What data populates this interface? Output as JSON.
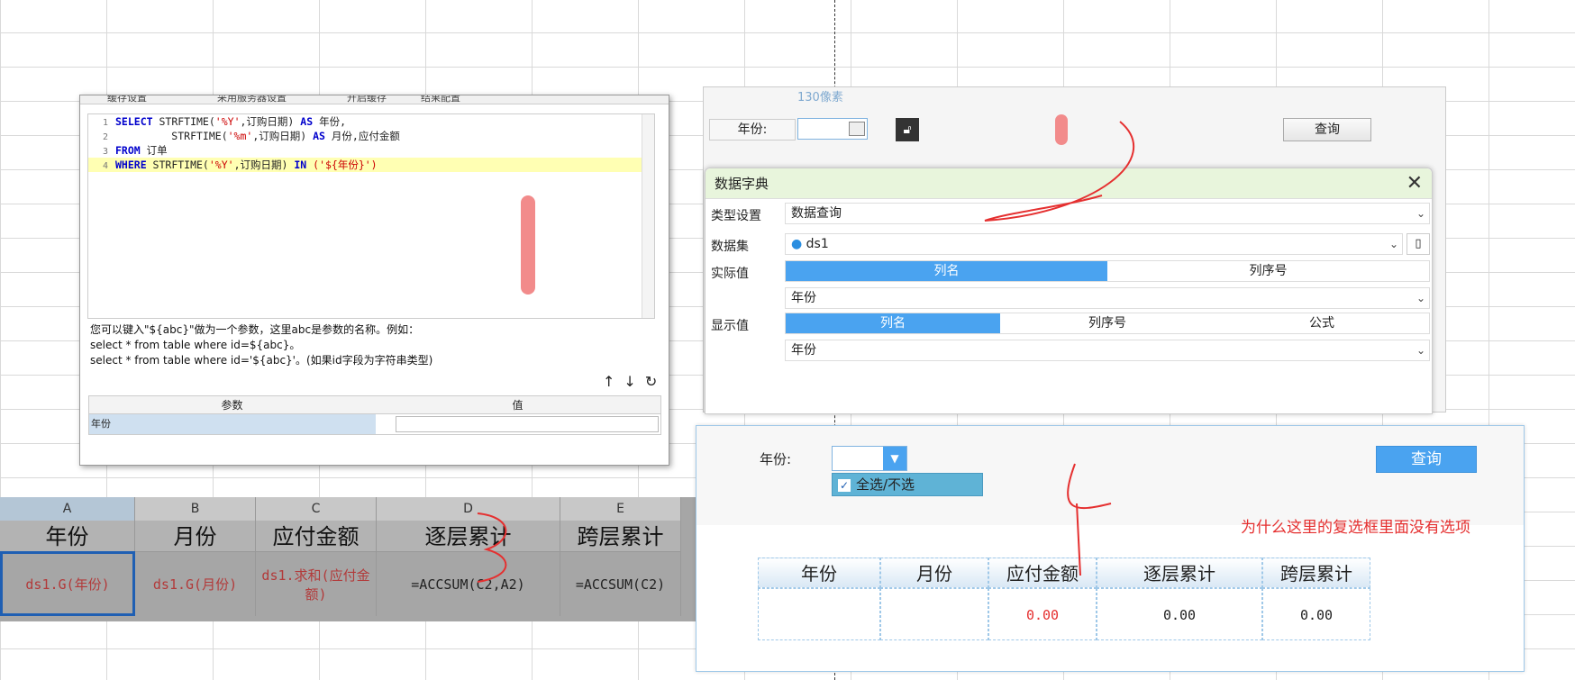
{
  "sql": {
    "toolbar_label": "缓存设置",
    "toolbar_select": "采用服务器设置",
    "toolbar_check": "开启缓存",
    "toolbar_button": "结果配置",
    "lines": [
      {
        "n": "1",
        "kw1": "SELECT",
        "t1": " STRFTIME(",
        "s1": "'%Y'",
        "t2": ",订购日期) ",
        "kw2": "AS",
        "t3": " 年份,"
      },
      {
        "n": "2",
        "kw1": "",
        "t1": "         STRFTIME(",
        "s1": "'%m'",
        "t2": ",订购日期) ",
        "kw2": "AS",
        "t3": " 月份,应付金额"
      },
      {
        "n": "3",
        "kw1": "FROM",
        "t1": " 订单",
        "s1": "",
        "t2": "",
        "kw2": "",
        "t3": ""
      },
      {
        "n": "4",
        "kw1": "WHERE",
        "t1": " STRFTIME(",
        "s1": "'%Y'",
        "t2": ",订购日期) ",
        "kw2": "IN",
        "t3": " ('${年份}')"
      }
    ],
    "hint1": "您可以键入\"${abc}\"做为一个参数，这里abc是参数的名称。例如：",
    "hint2": "select * from table where id=${abc}。",
    "hint3": "select * from table where id='${abc}'。(如果id字段为字符串类型)",
    "param_header": "参数",
    "value_header": "值",
    "param_name": "年份"
  },
  "sheet": {
    "cols": [
      "A",
      "B",
      "C",
      "D",
      "E"
    ],
    "headers": [
      "年份",
      "月份",
      "应付金额",
      "逐层累计",
      "跨层累计"
    ],
    "cells": [
      "ds1.G(年份)",
      "ds1.G(月份)",
      "ds1.求和(应付金额)",
      "=ACCSUM(C2,A2)",
      "=ACCSUM(C2)"
    ]
  },
  "preview_top": {
    "pixel_label": "130像素",
    "year_label": "年份:",
    "query_label": "查询"
  },
  "dict": {
    "title": "数据字典",
    "type_label": "类型设置",
    "type_value": "数据查询",
    "dataset_label": "数据集",
    "dataset_value": "ds1",
    "actual_label": "实际值",
    "actual_seg": [
      "列名",
      "列序号"
    ],
    "actual_value": "年份",
    "display_label": "显示值",
    "display_seg": [
      "列名",
      "列序号",
      "公式"
    ],
    "display_value": "年份"
  },
  "preview_bot": {
    "year_label": "年份:",
    "dropdown_item": "全选/不选",
    "query_label": "查询",
    "question": "为什么这里的复选框里面没有选项",
    "headers": [
      "年份",
      "月份",
      "应付金额",
      "逐层累计",
      "跨层累计"
    ],
    "values": [
      "",
      "",
      "0.00",
      "0.00",
      "0.00"
    ]
  }
}
